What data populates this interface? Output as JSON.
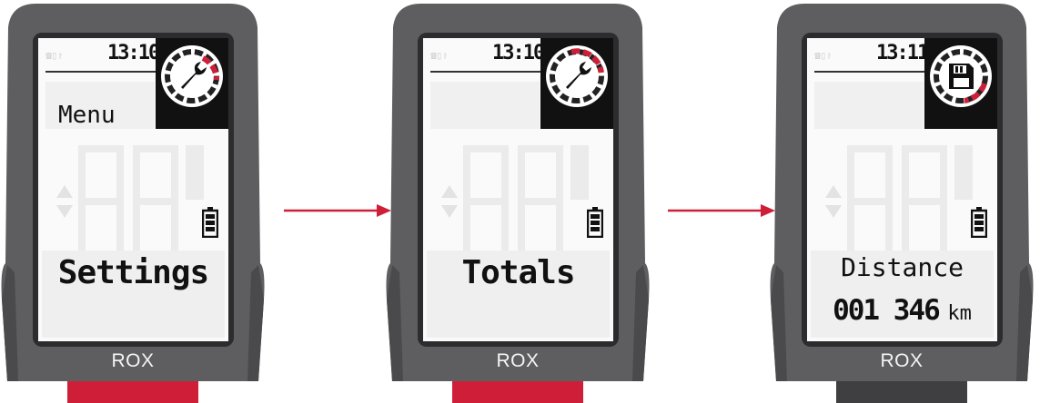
{
  "colors": {
    "shell": "#5e5e60",
    "shell_dark": "#3f3f41",
    "accent_red": "#cf1f38",
    "screen_bg": "#fafafa"
  },
  "steps": [
    {
      "time": "13:10",
      "badge_icon": "wrench-icon",
      "mode_label": "Menu",
      "main_value": "Settings",
      "brand": "ROX"
    },
    {
      "time": "13:10",
      "badge_icon": "wrench-icon",
      "mode_label": "",
      "main_value": "Totals",
      "brand": "ROX"
    },
    {
      "time": "13:11",
      "badge_icon": "floppy-disk-icon",
      "mode_label": "",
      "field_label": "Distance",
      "field_value": "001 346",
      "field_unit": "km",
      "brand": "ROX"
    }
  ],
  "connector_icon": "arrow-right-icon"
}
